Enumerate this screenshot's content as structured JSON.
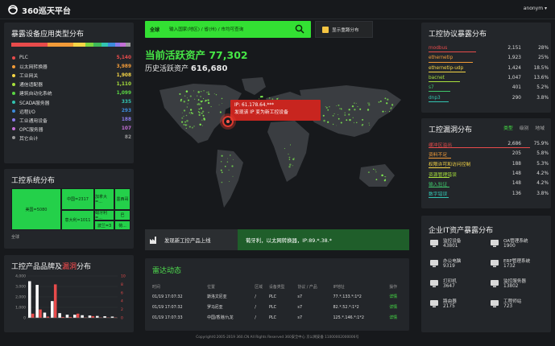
{
  "header": {
    "logo_text": "360巡天平台",
    "user": "anonym ▾"
  },
  "device_types": {
    "title": "暴露设备应用类型分布",
    "bar_colors": [
      "#e84b4b",
      "#f29b38",
      "#f5d546",
      "#7bd53f",
      "#3db85a",
      "#32c4b1",
      "#3b8bdb",
      "#8a79e8",
      "#c46fd6",
      "#9a9a9a"
    ],
    "items": [
      {
        "name": "PLC",
        "value": "5,140",
        "color": "#e84b4b"
      },
      {
        "name": "以太网转换器",
        "value": "3,989",
        "color": "#f29b38"
      },
      {
        "name": "工业网关",
        "value": "1,908",
        "color": "#f5d546"
      },
      {
        "name": "通信适配器",
        "value": "1,110",
        "color": "#a8e03c"
      },
      {
        "name": "建筑自动化系统",
        "value": "1,099",
        "color": "#5ad643"
      },
      {
        "name": "SCADA服务器",
        "value": "335",
        "color": "#32c4b1"
      },
      {
        "name": "远程I/O",
        "value": "293",
        "color": "#3b8bdb"
      },
      {
        "name": "工业通用设备",
        "value": "188",
        "color": "#8a79e8"
      },
      {
        "name": "OPC服务器",
        "value": "107",
        "color": "#c46fd6"
      },
      {
        "name": "其它合计",
        "value": "82",
        "color": "#9a9a9a"
      }
    ]
  },
  "systems": {
    "title": "工控系统分布",
    "cells": [
      {
        "label": "美国=5080"
      },
      {
        "label": "中国=2317"
      },
      {
        "label": "加拿大=..."
      },
      {
        "label": "墨西哥"
      },
      {
        "label": "意大利=1011"
      },
      {
        "label": "匈牙利=..."
      },
      {
        "label": "巴"
      },
      {
        "label": "波兰=3"
      },
      {
        "label": "荷..."
      }
    ],
    "note": "全球"
  },
  "brand": {
    "title_prefix": "工控产品品牌及",
    "title_highlight": "漏洞",
    "title_suffix": "分布",
    "yticks_left": [
      "4,000",
      "3,000",
      "2,000",
      "1,000",
      "0"
    ],
    "yticks_right": [
      "10",
      "8",
      "6",
      "4",
      "2",
      "0"
    ]
  },
  "chart_data": {
    "type": "bar",
    "categories": [
      "B1",
      "B2",
      "B3",
      "B4",
      "B5",
      "B6",
      "B7",
      "B8",
      "B9",
      "B10",
      "B11",
      "B12"
    ],
    "series": [
      {
        "values": [
          3500,
          3150,
          500,
          1600,
          450,
          300,
          300,
          250,
          220,
          180,
          150,
          120
        ]
      },
      {
        "values": [
          1,
          2,
          0.3,
          8,
          0.2,
          0.2,
          1,
          0.1,
          0.4,
          0.1,
          0.1,
          0.1
        ]
      }
    ],
    "ylim": [
      0,
      4000
    ],
    "y2lim": [
      0,
      10
    ]
  },
  "search": {
    "scope": "全球",
    "placeholder": "输入国家(地区) / 省(州) / 市均可查询"
  },
  "threat_button": "显示重蹲分布",
  "active": {
    "title": "当前活跃资产 77,302",
    "hist_label": "历史活跃资产",
    "hist_value": "616,680"
  },
  "popup": {
    "line1": "IP: 61.178.64.***",
    "line2": "发现该 IP 变为新工控设备"
  },
  "newproduct": {
    "label": "发现新工控产品上线",
    "text": "葡牙利，以太网转换器，IP:89.*.38.*"
  },
  "radar": {
    "title": "雷达动态",
    "headers": [
      "时间",
      "位置",
      "区域",
      "设备类型",
      "协议 / 产品",
      "IP地址",
      "操作"
    ],
    "rows": [
      [
        "01/19 17:07:32",
        "斯洛文尼亚",
        "/",
        "PLC",
        "s7",
        "77.*.133.*:1*2",
        "详情"
      ],
      [
        "01/19 17:07:32",
        "罗马尼亚",
        "/",
        "PLC",
        "s7",
        "82.*.52.*:1*2",
        "详情"
      ],
      [
        "01/19 17:07:33",
        "中国/香港/九龙",
        "/",
        "PLC",
        "s7",
        "125.*.146.*:1*2",
        "详情"
      ]
    ]
  },
  "protocols": {
    "title": "工控协议暴露分布",
    "rows": [
      {
        "name": "modbus",
        "count": "2,151",
        "pct": "28%",
        "color": "#e84b4b"
      },
      {
        "name": "ethernetip",
        "count": "1,923",
        "pct": "25%",
        "color": "#f29b38"
      },
      {
        "name": "ethernetip-udp",
        "count": "1,424",
        "pct": "18.5%",
        "color": "#f5d546"
      },
      {
        "name": "bacnet",
        "count": "1,047",
        "pct": "13.6%",
        "color": "#a8e03c"
      },
      {
        "name": "s7",
        "count": "401",
        "pct": "5.2%",
        "color": "#3fc46a"
      },
      {
        "name": "dnp3",
        "count": "290",
        "pct": "3.8%",
        "color": "#32c4b1"
      }
    ]
  },
  "vulns": {
    "title": "工控漏洞分布",
    "tabs": [
      "类型",
      "级别",
      "地域"
    ],
    "rows": [
      {
        "name": "缓冲区溢出",
        "count": "2,686",
        "pct": "75.9%",
        "color": "#e84b4b"
      },
      {
        "name": "资料不足",
        "count": "205",
        "pct": "5.8%",
        "color": "#f29b38"
      },
      {
        "name": "权限许可和访问控制",
        "count": "188",
        "pct": "5.3%",
        "color": "#f5d546"
      },
      {
        "name": "资源管理错误",
        "count": "148",
        "pct": "4.2%",
        "color": "#a8e03c"
      },
      {
        "name": "输入验证",
        "count": "148",
        "pct": "4.2%",
        "color": "#3fc46a"
      },
      {
        "name": "数字错误",
        "count": "136",
        "pct": "3.8%",
        "color": "#32c4b1"
      }
    ]
  },
  "itassets": {
    "title": "企业IT资产暴露分布",
    "items": [
      {
        "name": "监控设备",
        "value": "43801",
        "icon": "camera-icon"
      },
      {
        "name": "OA管理系统",
        "value": "1900",
        "icon": "monitor-icon"
      },
      {
        "name": "办公电脑",
        "value": "9319",
        "icon": "desktop-icon"
      },
      {
        "name": "ERP管理系统",
        "value": "1732",
        "icon": "server-icon"
      },
      {
        "name": "打印机",
        "value": "3647",
        "icon": "printer-icon"
      },
      {
        "name": "监控服务器",
        "value": "13802",
        "icon": "server-rack-icon"
      },
      {
        "name": "路由器",
        "value": "2175",
        "icon": "router-icon"
      },
      {
        "name": "工程师站",
        "value": "723",
        "icon": "workstation-icon"
      }
    ]
  },
  "footer": "Copyright©2005-2019 360.CN All Rights Reserved 360安全中心   京公网安备 11000002000006号"
}
